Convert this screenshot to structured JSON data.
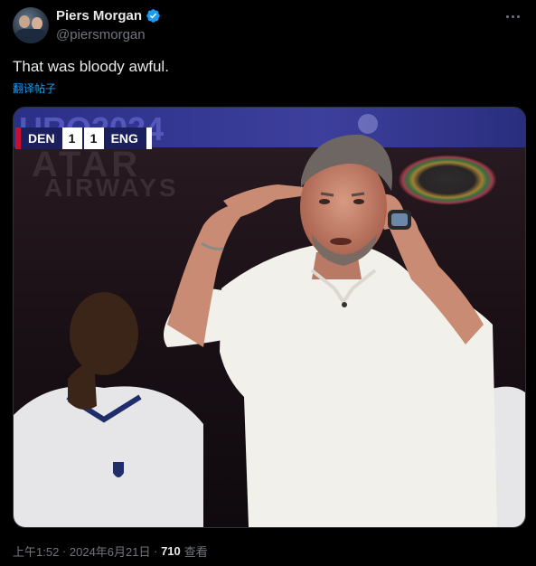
{
  "author": {
    "display_name": "Piers Morgan",
    "handle": "@piersmorgan",
    "verified": true
  },
  "tweet": {
    "text": "That was bloody awful.",
    "translate_label": "翻译帖子"
  },
  "media": {
    "tournament_banner": "URO2024",
    "sponsor_text_1": "ATAR",
    "sponsor_text_2": "AIRWAYS",
    "scoreboard": {
      "home_team": "DEN",
      "home_score": "1",
      "away_score": "1",
      "away_team": "ENG"
    }
  },
  "footer": {
    "time": "上午1:52",
    "separator": " · ",
    "date": "2024年6月21日",
    "separator2": " · ",
    "views": "710",
    "views_label": "查看"
  },
  "colors": {
    "background": "#000000",
    "text_primary": "#e7e9ea",
    "text_secondary": "#71767b",
    "link": "#1d9bf0",
    "verified": "#1d9bf0"
  },
  "icons": {
    "verified": "verified-badge-icon",
    "more": "more-dots-icon"
  }
}
